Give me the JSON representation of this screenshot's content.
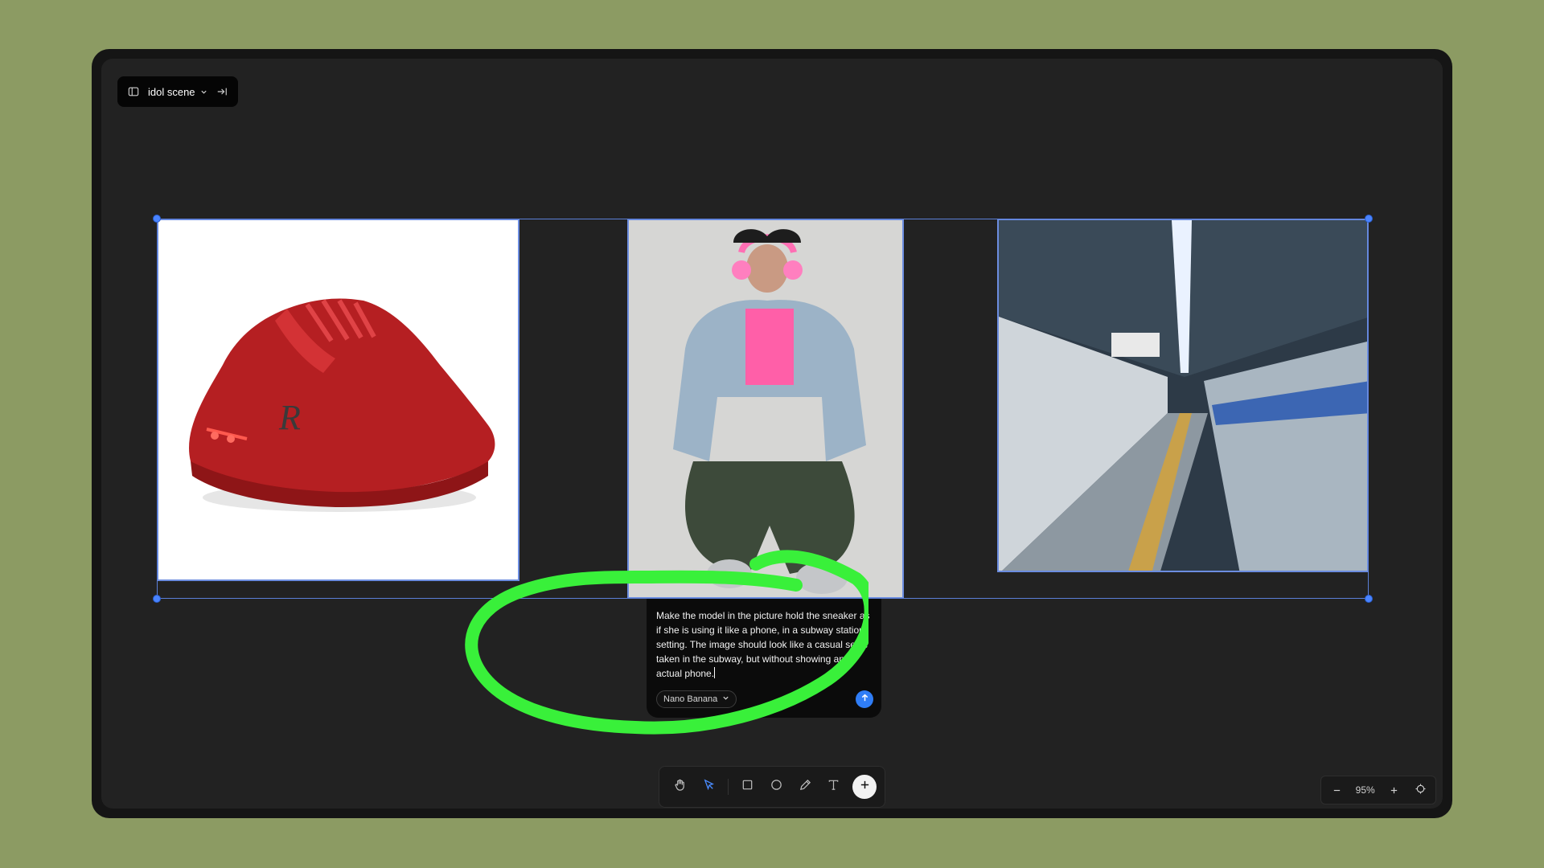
{
  "header": {
    "scene_name": "idol scene",
    "icons": [
      "sidebar-icon",
      "chevron-down-icon",
      "collapse-right-icon"
    ]
  },
  "canvas": {
    "images": [
      {
        "name": "red sneaker"
      },
      {
        "name": "model in denim jacket"
      },
      {
        "name": "subway station"
      }
    ]
  },
  "prompt": {
    "text": "Make the model in the picture hold the sneaker as if she is using it like a phone, in a subway station setting. The image should look like a casual selfie taken in the subway, but without showing any actual phone.",
    "model_label": "Nano Banana"
  },
  "toolbar": {
    "tools": [
      "hand-icon",
      "select-icon",
      "rectangle-icon",
      "ellipse-icon",
      "pencil-icon",
      "text-icon",
      "add-icon"
    ]
  },
  "zoom": {
    "level": "95%"
  },
  "colors": {
    "accent_blue": "#2f7df6",
    "selection": "#5b7fd8",
    "annotation_green": "#39f03a",
    "background": "#8c9b63"
  }
}
